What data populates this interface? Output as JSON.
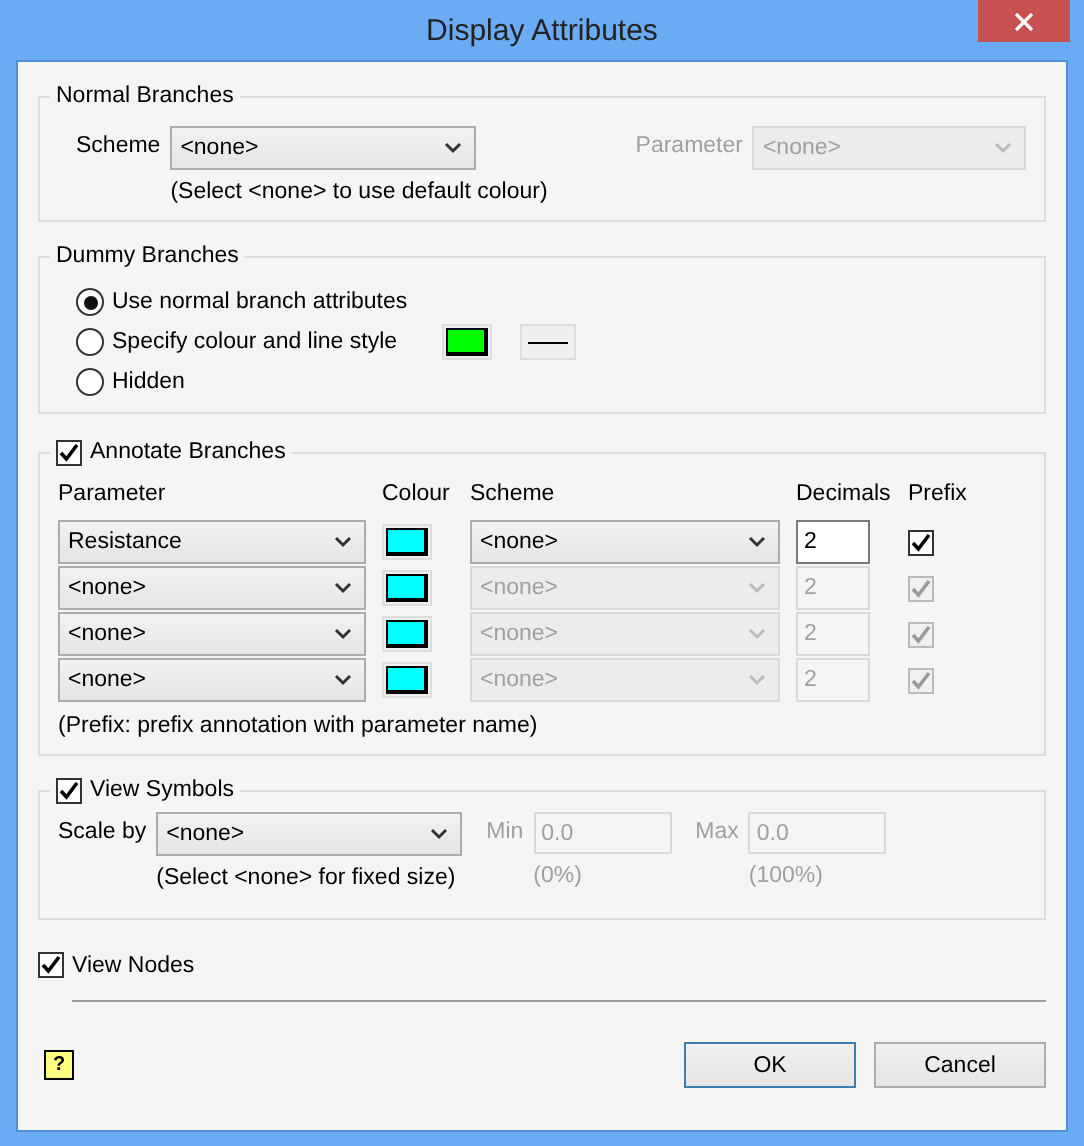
{
  "window": {
    "title": "Display Attributes"
  },
  "normal_branches": {
    "title": "Normal Branches",
    "scheme_label": "Scheme",
    "scheme": "<none>",
    "hint": "(Select <none> to use default colour)",
    "parameter_label": "Parameter",
    "parameter": "<none>",
    "parameter_disabled": true
  },
  "dummy_branches": {
    "title": "Dummy Branches",
    "options": [
      {
        "label": "Use normal branch attributes",
        "selected": true
      },
      {
        "label": "Specify colour and line style",
        "selected": false
      },
      {
        "label": "Hidden",
        "selected": false
      }
    ]
  },
  "annotate_branches": {
    "label": "Annotate Branches",
    "checked": true,
    "columns": [
      "Parameter",
      "Colour",
      "Scheme",
      "Decimals",
      "Prefix"
    ],
    "rows": [
      {
        "parameter": "Resistance",
        "color": "#00ffff",
        "scheme": "<none>",
        "decimals": "2",
        "prefix": true,
        "disabled": false
      },
      {
        "parameter": "<none>",
        "color": "#00ffff",
        "scheme": "<none>",
        "decimals": "2",
        "prefix": true,
        "disabled": true
      },
      {
        "parameter": "<none>",
        "color": "#00ffff",
        "scheme": "<none>",
        "decimals": "2",
        "prefix": true,
        "disabled": true
      },
      {
        "parameter": "<none>",
        "color": "#00ffff",
        "scheme": "<none>",
        "decimals": "2",
        "prefix": true,
        "disabled": true
      }
    ],
    "note": "(Prefix:  prefix annotation with parameter name)"
  },
  "view_symbols": {
    "label": "View Symbols",
    "checked": true,
    "scale_label": "Scale by",
    "scale": "<none>",
    "hint": "(Select <none> for fixed size)",
    "range_disabled": true,
    "min_label": "Min",
    "min": "0.0",
    "min_hint": "(0%)",
    "max_label": "Max",
    "max": "0.0",
    "max_hint": "(100%)"
  },
  "view_nodes": {
    "label": "View Nodes",
    "checked": true
  },
  "help_icon": "?",
  "buttons": [
    {
      "label": "OK",
      "default": true
    },
    {
      "label": "Cancel",
      "default": false
    }
  ]
}
